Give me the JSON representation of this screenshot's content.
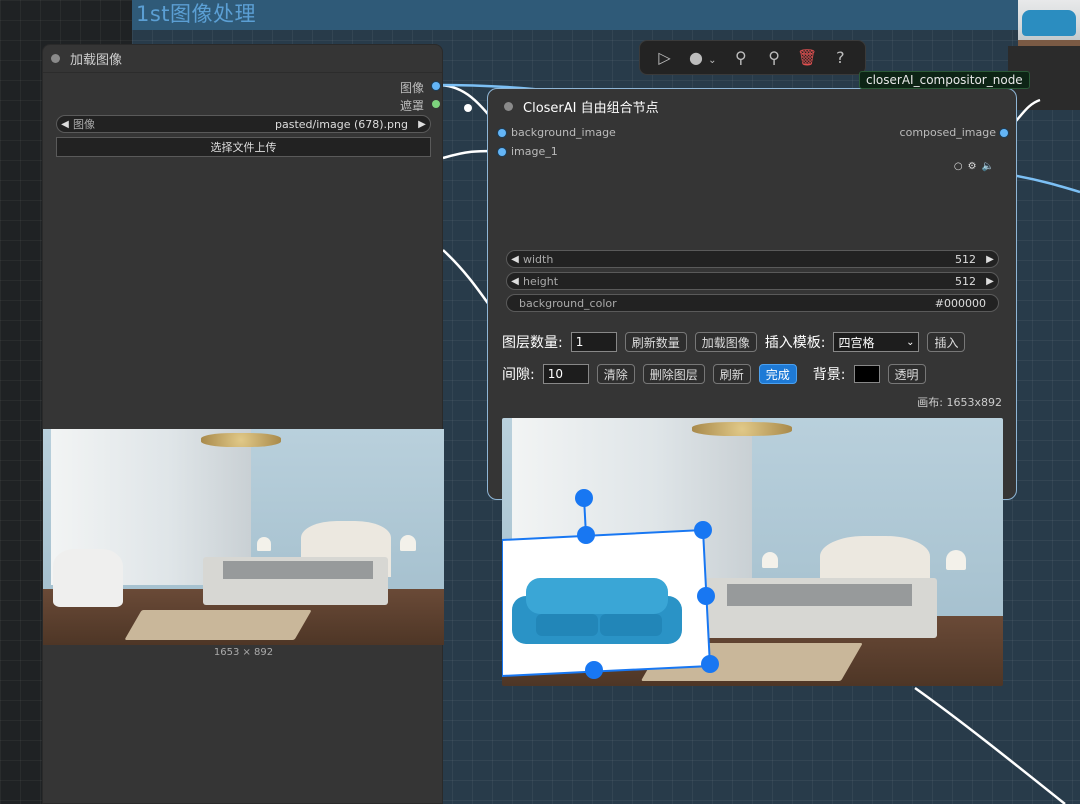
{
  "group": {
    "title": "1st图像处理"
  },
  "toolbar": {
    "icons": [
      "play-icon",
      "record-dot-icon",
      "chevron-down-icon",
      "magic-wand-icon",
      "pin-icon",
      "trash-icon",
      "help-icon"
    ]
  },
  "tooltip": "closerAI_compositor_node",
  "load_node": {
    "title": "加载图像",
    "outputs": {
      "image": "图像",
      "mask": "遮罩"
    },
    "image_combo": {
      "label": "图像",
      "value": "pasted/image (678).png"
    },
    "upload_label": "选择文件上传",
    "image_size": "1653 × 892"
  },
  "compositor_node": {
    "title": "CloserAI 自由组合节点",
    "inputs": [
      "background_image",
      "image_1"
    ],
    "output": "composed_image",
    "widgets": {
      "width": {
        "label": "width",
        "value": "512"
      },
      "height": {
        "label": "height",
        "value": "512"
      },
      "background_color": {
        "label": "background_color",
        "value": "#000000"
      }
    },
    "controls": {
      "layer_count_label": "图层数量:",
      "layer_count_value": "1",
      "refresh_count": "刷新数量",
      "load_image": "加载图像",
      "insert_template_label": "插入模板:",
      "template_value": "四宫格",
      "insert": "插入",
      "gap_label": "间隙:",
      "gap_value": "10",
      "clear": "清除",
      "delete_layer": "删除图层",
      "refresh": "刷新",
      "done": "完成",
      "background_label": "背景:",
      "transparent": "透明"
    },
    "canvas_size": "画布: 1653x892"
  },
  "colors": {
    "group_bg": "#283b4a",
    "group_header": "#2f5a78",
    "node_bg": "#353535",
    "accent_blue": "#1e7ad6",
    "handle_blue": "#1877f2",
    "tooltip_bg": "#0d2415"
  }
}
